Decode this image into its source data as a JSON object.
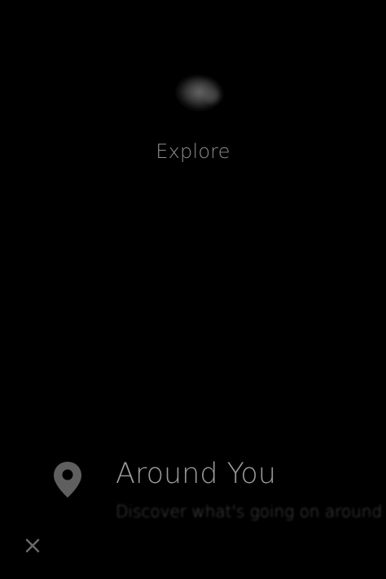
{
  "screen": {
    "title": "Explore"
  },
  "feature": {
    "title": "Around You",
    "subtitle": "Discover what's going on around you",
    "icon": "location-pin-icon"
  },
  "controls": {
    "close_icon": "close-icon"
  },
  "colors": {
    "background": "#000000",
    "text": "#9a9a9a",
    "icon": "#5f5f5f"
  }
}
